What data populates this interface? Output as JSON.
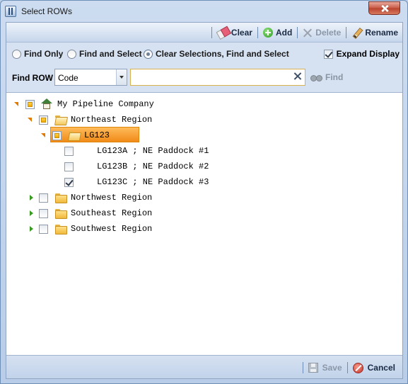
{
  "window": {
    "title": "Select ROWs"
  },
  "toolbar": {
    "clear_label": "Clear",
    "add_label": "Add",
    "delete_label": "Delete",
    "rename_label": "Rename"
  },
  "options": {
    "find_only": "Find Only",
    "find_and_select": "Find and Select",
    "clear_find_select": "Clear Selections, Find and Select",
    "selected": "Clear Selections, Find and Select",
    "expand_display": "Expand Display",
    "expand_checked": true
  },
  "find": {
    "label": "Find ROW",
    "field_value": "Code",
    "search_value": "",
    "find_label": "Find"
  },
  "tree": {
    "root": "My Pipeline Company",
    "northeast": "Northeast Region",
    "lg123": "LG123",
    "lg123a": "LG123A ; NE Paddock #1",
    "lg123b": "LG123B ; NE Paddock #2",
    "lg123c": "LG123C ; NE Paddock #3",
    "northwest": "Northwest Region",
    "southeast": "Southeast Region",
    "southwest": "Southwest Region",
    "selected": "LG123",
    "checked": [
      "LG123C ; NE Paddock #3"
    ]
  },
  "footer": {
    "save_label": "Save",
    "cancel_label": "Cancel"
  },
  "colors": {
    "selection": "#f59a2a",
    "accent": "#bcd1ea"
  }
}
